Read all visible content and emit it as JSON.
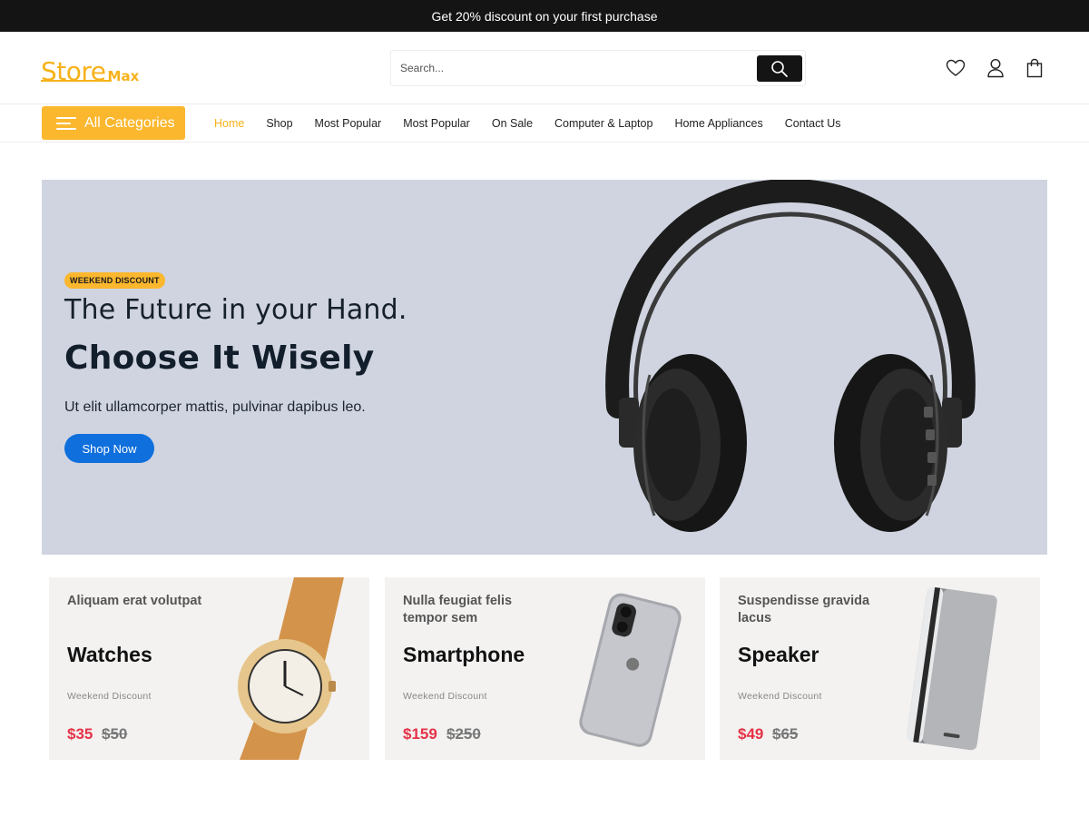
{
  "topbar": {
    "text": "Get 20% discount on your first purchase"
  },
  "header": {
    "logo_main": "Store",
    "logo_sub": "Max",
    "search_placeholder": "Search...",
    "icons": [
      "heart-icon",
      "user-icon",
      "shopping-bag-icon"
    ]
  },
  "nav": {
    "categories_label": "All Categories",
    "links": [
      "Home",
      "Shop",
      "Most Popular",
      "Most Popular",
      "On Sale",
      "Computer & Laptop",
      "Home Appliances",
      "Contact Us"
    ],
    "active_index": 0
  },
  "hero": {
    "badge": "WEEKEND DISCOUNT",
    "subtitle": "The Future in your Hand.",
    "title": "Choose It Wisely",
    "description": "Ut elit ullamcorper mattis, pulvinar dapibus leo.",
    "cta": "Shop Now"
  },
  "cards": [
    {
      "subtitle": "Aliquam erat volutpat",
      "title": "Watches",
      "tag": "Weekend Discount",
      "price": "$35",
      "old_price": "$50"
    },
    {
      "subtitle": "Nulla feugiat felis tempor sem",
      "title": "Smartphone",
      "tag": "Weekend Discount",
      "price": "$159",
      "old_price": "$250"
    },
    {
      "subtitle": "Suspendisse gravida lacus",
      "title": "Speaker",
      "tag": "Weekend Discount",
      "price": "$49",
      "old_price": "$65"
    }
  ],
  "colors": {
    "accent": "#fbb72e",
    "topbar": "#141414",
    "hero_bg": "#cfd4e0",
    "cta": "#0f6fdc",
    "price": "#e53246"
  }
}
